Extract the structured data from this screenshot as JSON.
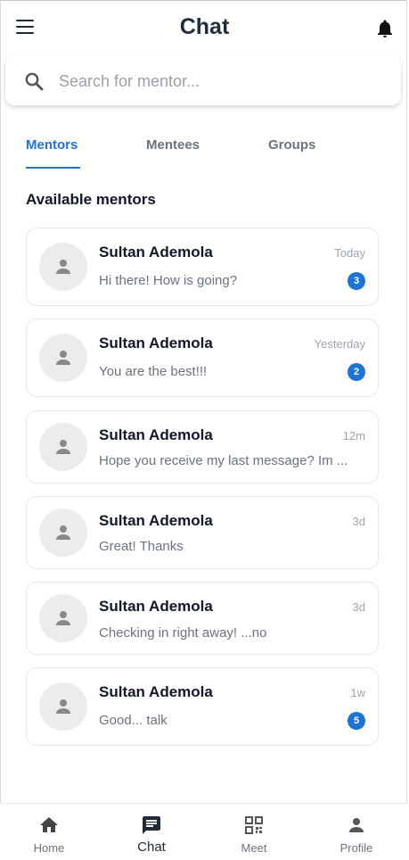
{
  "header": {
    "title": "Chat",
    "menu_icon": "hamburger-menu-icon",
    "notify_icon": "bell-icon"
  },
  "search": {
    "placeholder": "Search for mentor..."
  },
  "tabs": [
    {
      "label": "Mentors",
      "active": true
    },
    {
      "label": "Mentees",
      "active": false
    },
    {
      "label": "Groups",
      "active": false
    }
  ],
  "section_title": "Available mentors",
  "chats": [
    {
      "name": "Sultan Ademola",
      "message": "Hi there! How is going?",
      "time": "Today",
      "unread": "3"
    },
    {
      "name": "Sultan Ademola",
      "message": "You are the best!!!",
      "time": "Yesterday",
      "unread": "2"
    },
    {
      "name": "Sultan Ademola",
      "message": "Hope you receive my last message? Im ...",
      "time": "12m",
      "unread": null
    },
    {
      "name": "Sultan Ademola",
      "message": "Great! Thanks",
      "time": "3d",
      "unread": null
    },
    {
      "name": "Sultan Ademola",
      "message": "Checking in right away! ...no",
      "time": "3d",
      "unread": null
    },
    {
      "name": "Sultan Ademola",
      "message": "Good... talk",
      "time": "1w",
      "unread": "5"
    }
  ],
  "nav": [
    {
      "label": "Home",
      "icon": "home-icon",
      "active": false
    },
    {
      "label": "Chat",
      "icon": "chat-icon",
      "active": true
    },
    {
      "label": "Meet",
      "icon": "qr-code-icon",
      "active": false
    },
    {
      "label": "Profile",
      "icon": "person-icon",
      "active": false
    }
  ],
  "colors": {
    "accent": "#1e73d6",
    "title": "#1f2d3d",
    "muted": "#6b7280"
  }
}
